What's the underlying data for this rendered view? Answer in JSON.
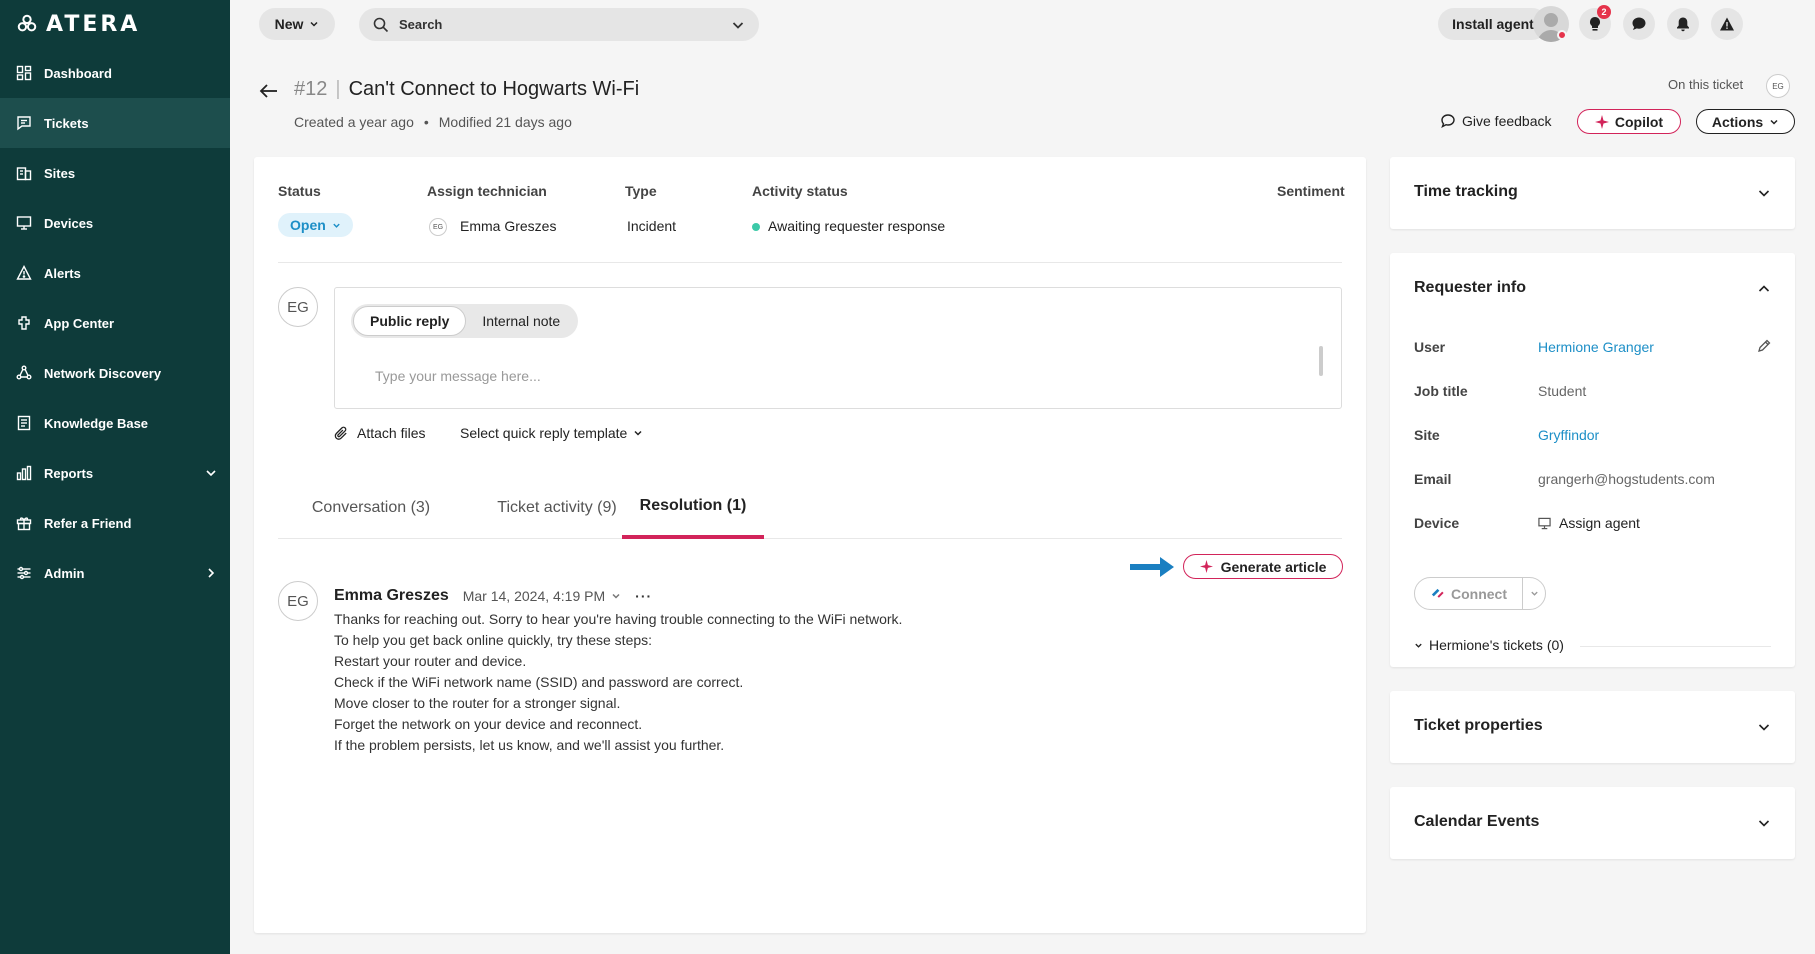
{
  "app": {
    "brand": "ATERA"
  },
  "sidebar": {
    "items": [
      {
        "label": "Dashboard",
        "icon": "dashboard-icon"
      },
      {
        "label": "Tickets",
        "icon": "tickets-icon",
        "active": true
      },
      {
        "label": "Sites",
        "icon": "sites-icon"
      },
      {
        "label": "Devices",
        "icon": "devices-icon"
      },
      {
        "label": "Alerts",
        "icon": "alerts-icon"
      },
      {
        "label": "App Center",
        "icon": "app-center-icon"
      },
      {
        "label": "Network Discovery",
        "icon": "network-icon"
      },
      {
        "label": "Knowledge Base",
        "icon": "knowledge-base-icon"
      },
      {
        "label": "Reports",
        "icon": "reports-icon"
      },
      {
        "label": "Refer a Friend",
        "icon": "gift-icon"
      },
      {
        "label": "Admin",
        "icon": "admin-icon"
      }
    ]
  },
  "topbar": {
    "new_label": "New",
    "search_placeholder": "Search",
    "install_label": "Install agent",
    "notification_count": "2"
  },
  "ticket": {
    "number": "#12",
    "title": "Can't Connect to Hogwarts Wi-Fi",
    "created": "Created a year ago",
    "bullet": "•",
    "modified": "Modified 21 days ago",
    "on_this_ticket": "On this ticket",
    "viewer_initials": "EG",
    "feedback_label": "Give feedback",
    "copilot_label": "Copilot",
    "actions_label": "Actions"
  },
  "fields": {
    "status_label": "Status",
    "status_value": "Open",
    "assign_label": "Assign technician",
    "assign_initials": "EG",
    "assign_value": "Emma Greszes",
    "type_label": "Type",
    "type_value": "Incident",
    "activity_label": "Activity status",
    "activity_value": "Awaiting requester response",
    "sentiment_label": "Sentiment"
  },
  "reply": {
    "user_initials": "EG",
    "tab_public": "Public reply",
    "tab_internal": "Internal note",
    "placeholder": "Type your message here...",
    "attach_label": "Attach files",
    "template_label": "Select quick reply template"
  },
  "tabs": [
    {
      "label": "Conversation (3)"
    },
    {
      "label": "Ticket activity (9)"
    },
    {
      "label": "Resolution (1)",
      "active": true
    }
  ],
  "resolution": {
    "generate_label": "Generate article",
    "author_initials": "EG",
    "author": "Emma Greszes",
    "date": "Mar 14, 2024, 4:19 PM",
    "more": "···",
    "lines": [
      "Thanks for reaching out. Sorry to hear you're having trouble connecting to the WiFi network.",
      "To help you get back online quickly, try these steps:",
      "Restart your router and device.",
      "Check if the WiFi network name (SSID) and password are correct.",
      "Move closer to the router for a stronger signal.",
      "Forget the network on your device and reconnect.",
      "If the problem persists, let us know, and we'll assist you further."
    ]
  },
  "panels": {
    "time_tracking": "Time tracking",
    "requester_info": "Requester info",
    "ticket_properties": "Ticket properties",
    "calendar_events": "Calendar Events"
  },
  "requester": {
    "user_label": "User",
    "user_value": "Hermione Granger",
    "job_label": "Job title",
    "job_value": "Student",
    "site_label": "Site",
    "site_value": "Gryffindor",
    "email_label": "Email",
    "email_value": "grangerh@hogstudents.com",
    "device_label": "Device",
    "device_value": "Assign agent",
    "connect_label": "Connect",
    "tickets_label": "Hermione's tickets (0)"
  },
  "colors": {
    "sidebar": "#0e3b3a",
    "accent": "#d2245a",
    "link": "#1d8fc7",
    "status_green": "#3cc9a8"
  }
}
